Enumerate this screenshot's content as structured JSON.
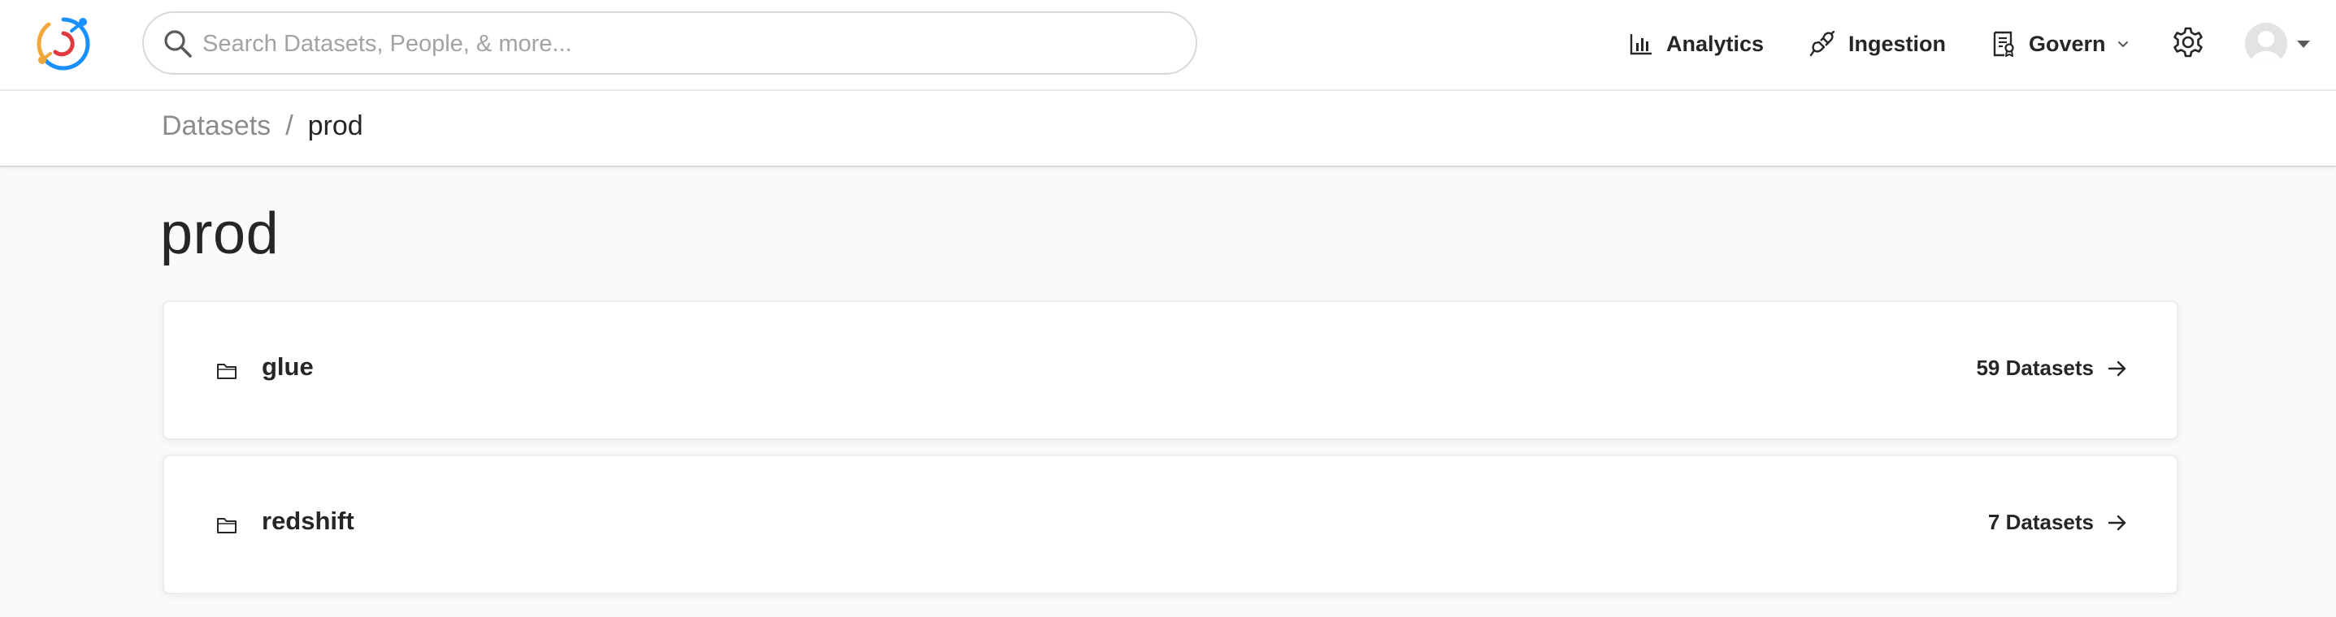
{
  "header": {
    "logo_icon": "datahub-logo-icon",
    "search": {
      "placeholder": "Search Datasets, People, & more...",
      "value": ""
    },
    "nav": {
      "analytics": {
        "label": "Analytics",
        "icon": "bar-chart-icon"
      },
      "ingestion": {
        "label": "Ingestion",
        "icon": "plug-icon"
      },
      "govern": {
        "label": "Govern",
        "icon": "document-icon"
      },
      "settings": {
        "icon": "gear-icon"
      },
      "user": {
        "icon": "avatar-icon"
      }
    }
  },
  "breadcrumb": {
    "root": "Datasets",
    "separator": "/",
    "current": "prod"
  },
  "page": {
    "title": "prod"
  },
  "items": [
    {
      "name": "glue",
      "count_label": "59 Datasets",
      "icon": "folder-icon"
    },
    {
      "name": "redshift",
      "count_label": "7 Datasets",
      "icon": "folder-icon"
    }
  ],
  "colors": {
    "logo_blue": "#1890ff",
    "logo_orange": "#f2a73b",
    "logo_red": "#e0393f",
    "text_primary": "#262626",
    "text_muted": "#8c8c8c"
  }
}
